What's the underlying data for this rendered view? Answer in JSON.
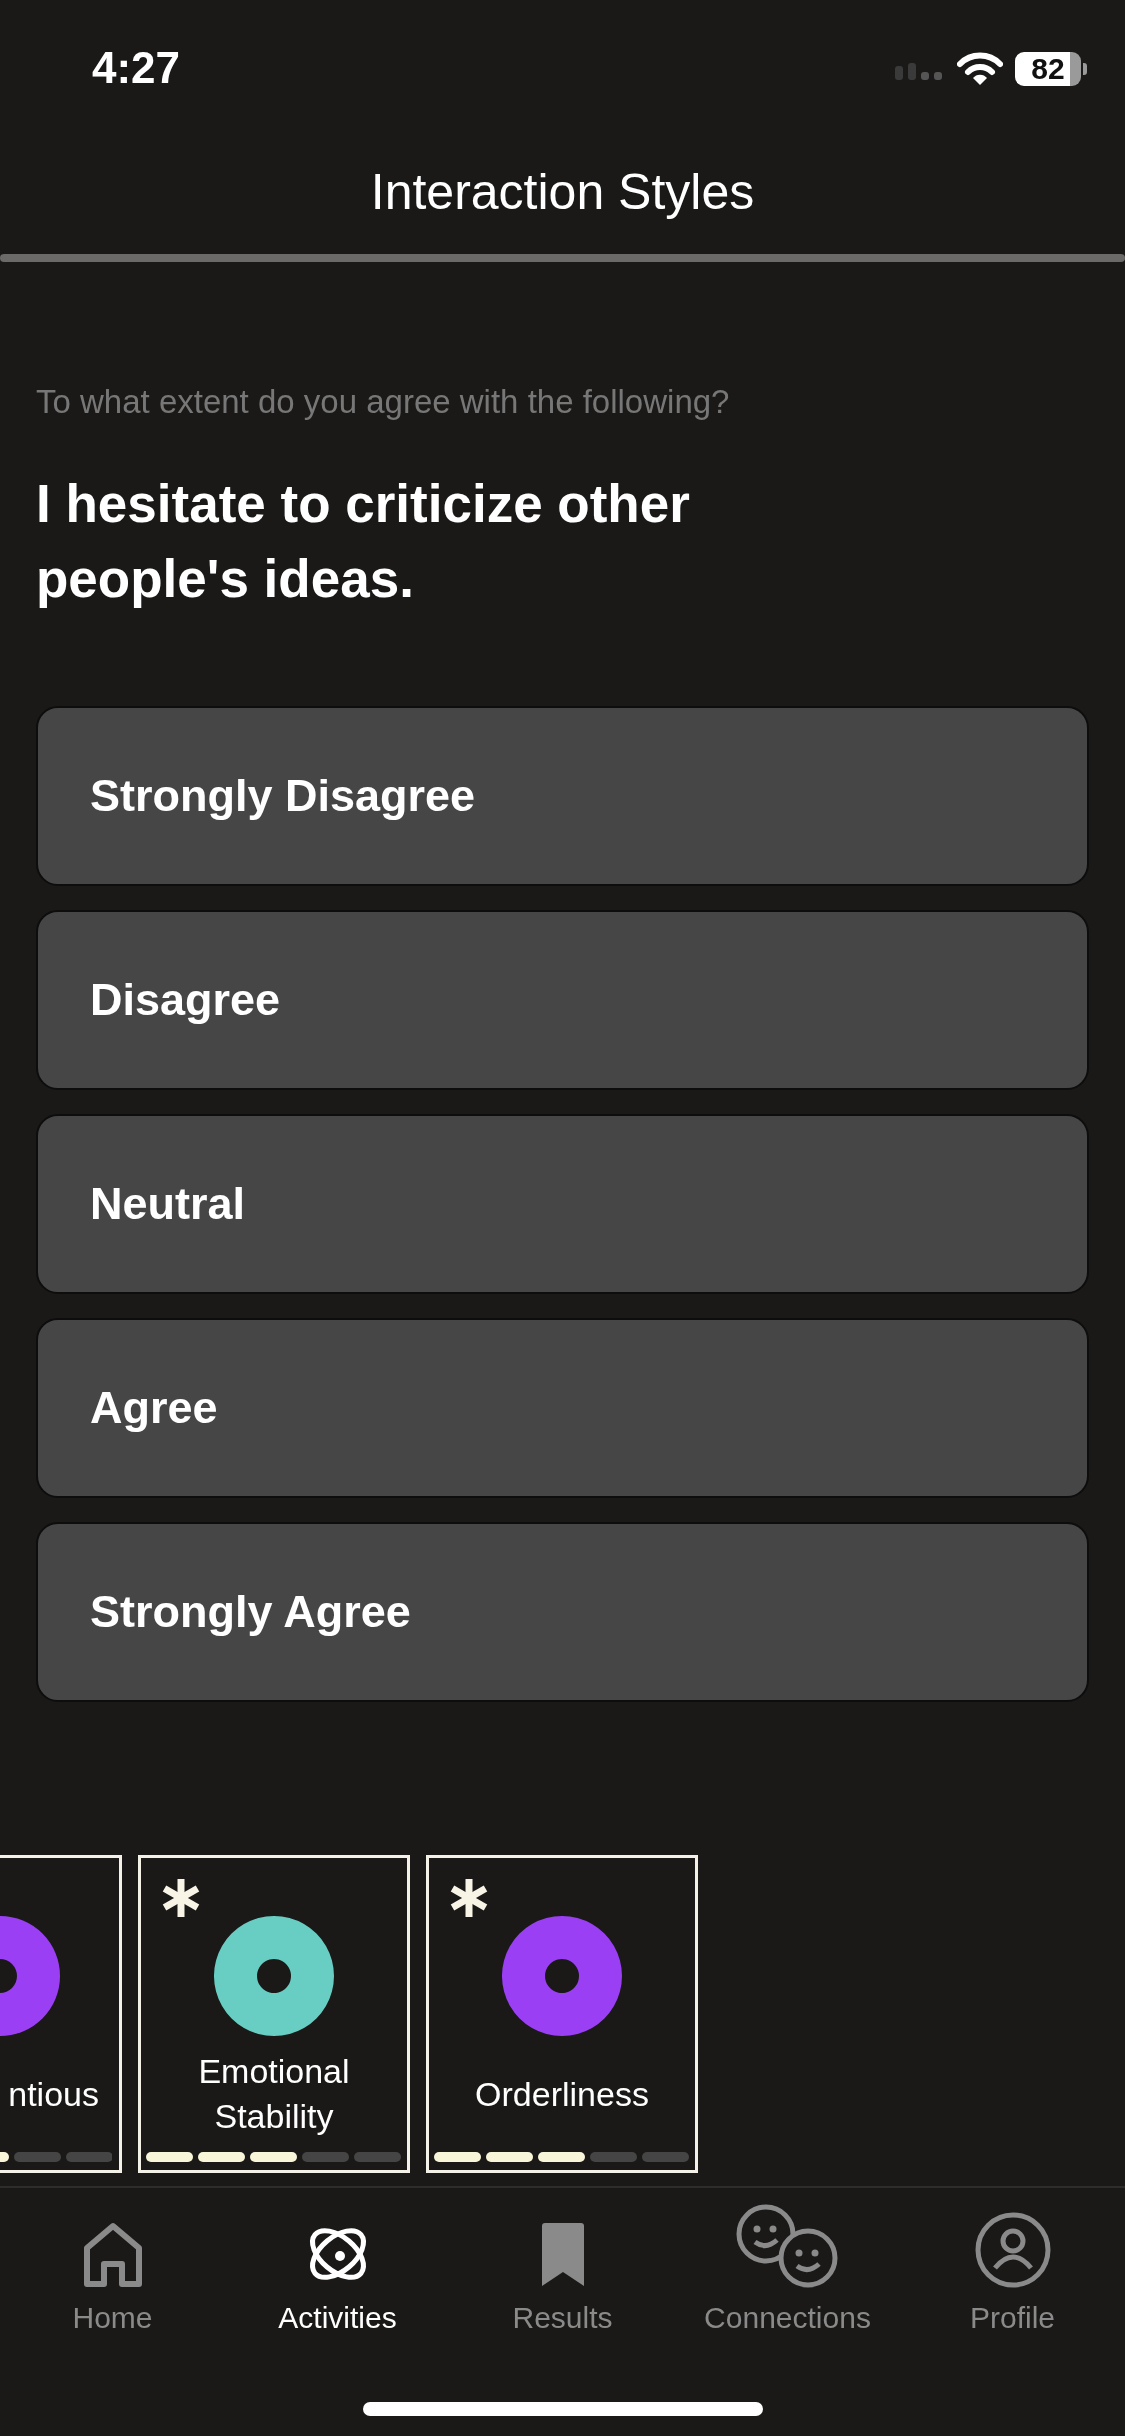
{
  "status_bar": {
    "time": "4:27",
    "battery": "82"
  },
  "header": {
    "title": "Interaction Styles"
  },
  "prompt": "To what extent do you agree with the following?",
  "question": "I hesitate to criticize other people's ideas.",
  "options": [
    "Strongly Disagree",
    "Disagree",
    "Neutral",
    "Agree",
    "Strongly Agree"
  ],
  "cards": [
    {
      "kind": "clipped",
      "label": "ntious",
      "color": "#9b3ff5",
      "marked": false,
      "level": 0.6
    },
    {
      "kind": "full",
      "label": "Emotional Stability",
      "color": "#68cec4",
      "marked": true,
      "level": 0.6
    },
    {
      "kind": "full",
      "label": "Orderliness",
      "color": "#9b3ff5",
      "marked": true,
      "level": 0.6
    }
  ],
  "tab_bar": [
    {
      "kind": "home",
      "label": "Home",
      "selected": false
    },
    {
      "kind": "orbit",
      "label": "Activities",
      "selected": true
    },
    {
      "kind": "bookmark",
      "label": "Results",
      "selected": false
    },
    {
      "kind": "faces",
      "label": "Connections",
      "selected": false
    },
    {
      "kind": "person",
      "label": "Profile",
      "selected": false
    }
  ]
}
